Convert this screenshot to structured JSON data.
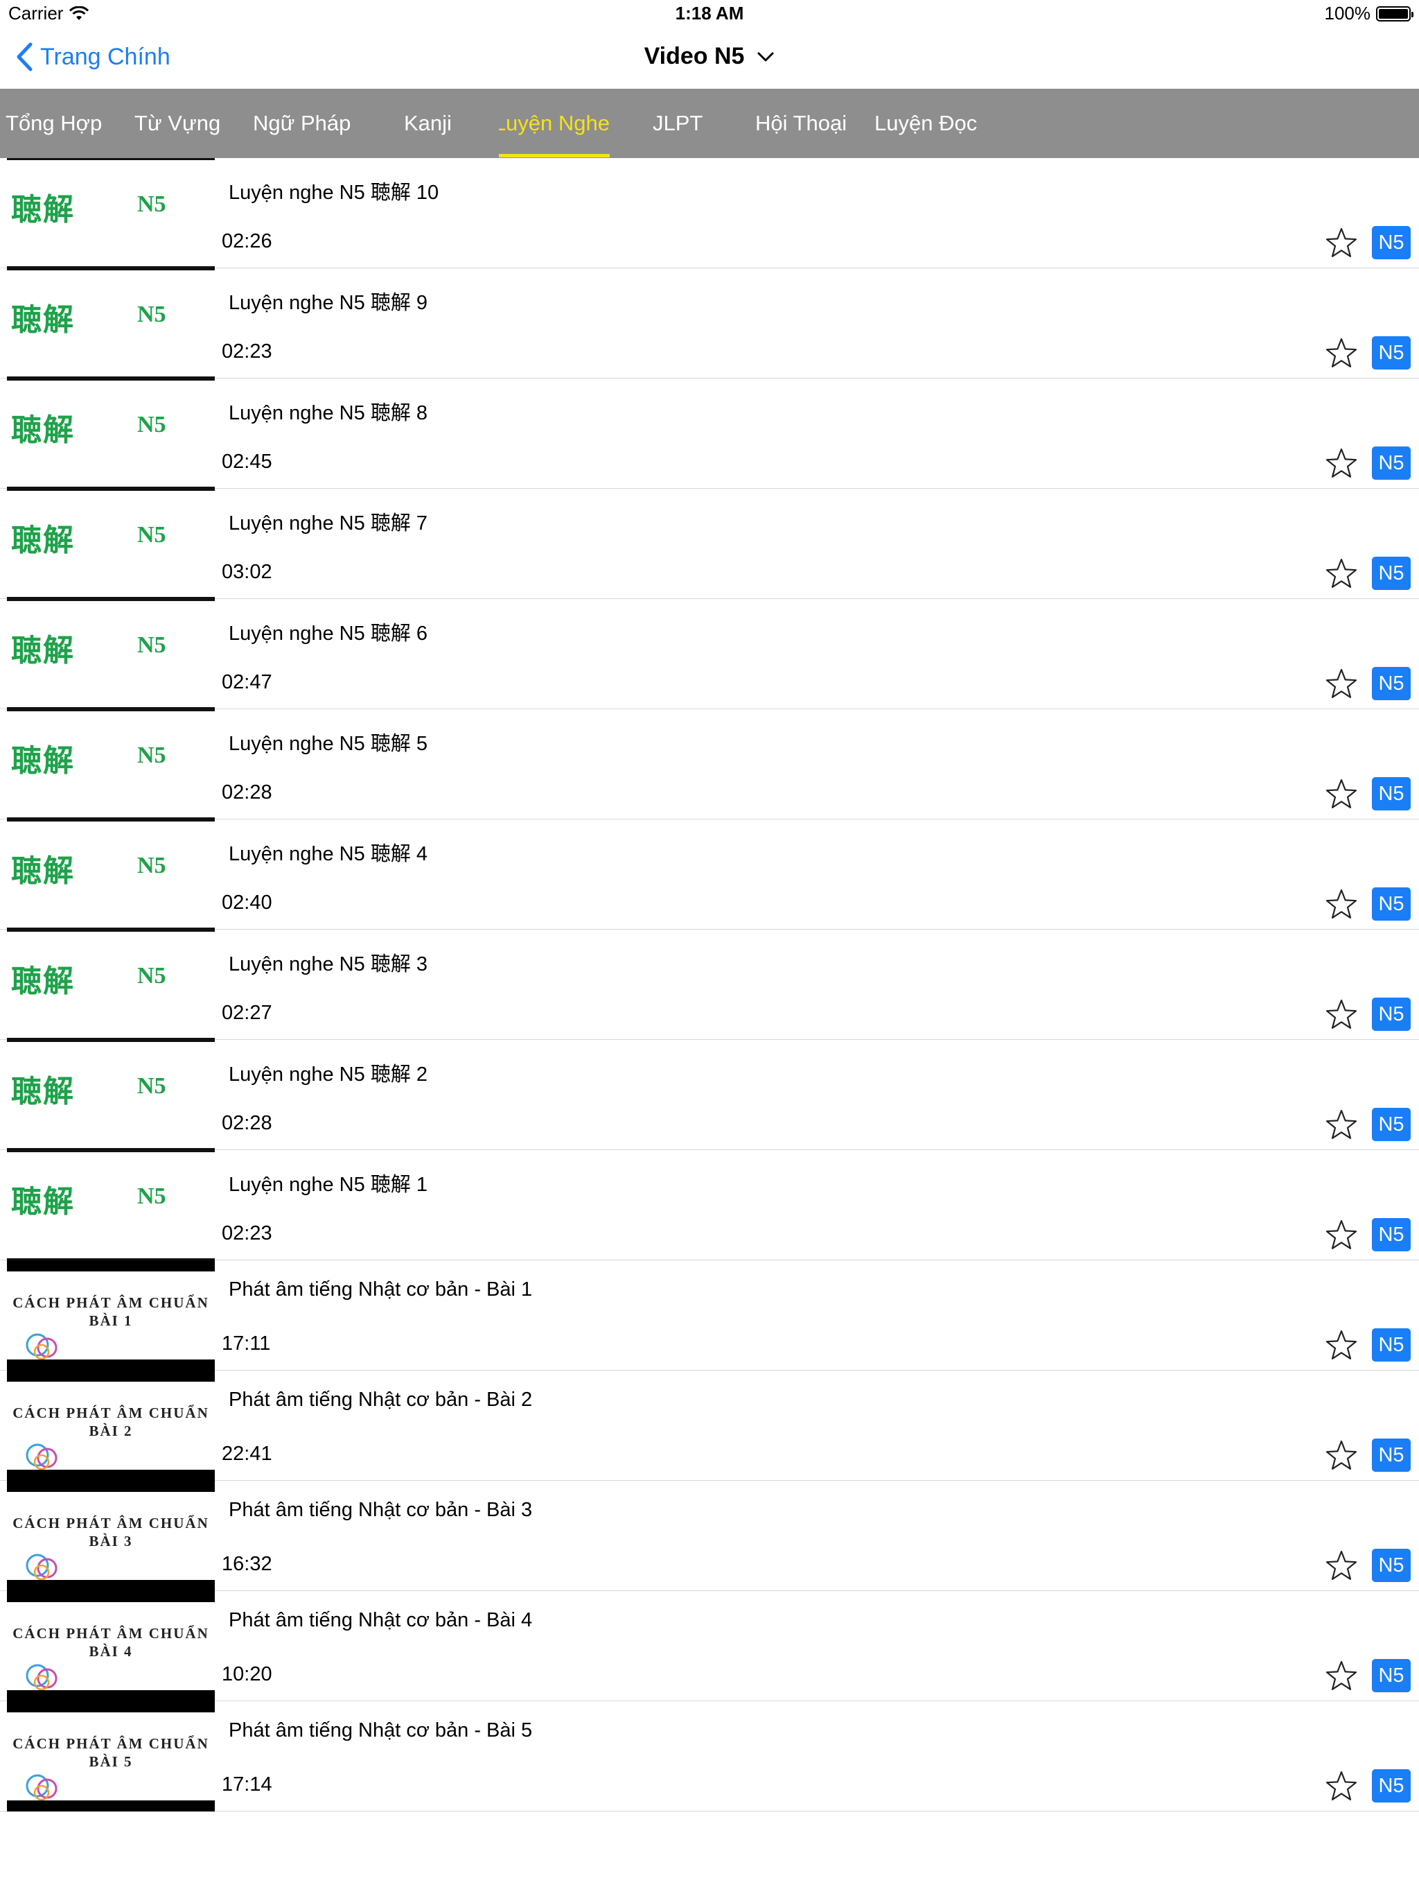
{
  "status_bar": {
    "carrier": "Carrier",
    "time": "1:18 AM",
    "battery": "100%"
  },
  "nav": {
    "back_label": "Trang Chính",
    "title": "Video N5"
  },
  "tabs": [
    {
      "label": "Tổng Hợp",
      "active": false
    },
    {
      "label": "Từ Vựng",
      "active": false
    },
    {
      "label": "Ngữ Pháp",
      "active": false
    },
    {
      "label": "Kanji",
      "active": false
    },
    {
      "label": "Luyện Nghe",
      "active": true
    },
    {
      "label": "JLPT",
      "active": false
    },
    {
      "label": "Hội Thoại",
      "active": false
    },
    {
      "label": "Luyện Đọc",
      "active": false
    }
  ],
  "colors": {
    "accent": "#1a7ef7",
    "tab_bg": "#8e8e8e",
    "tab_active": "#f5e21b",
    "thumb_green": "#1ea24a"
  },
  "listening_thumb": {
    "kanji": "聴解",
    "level": "N5"
  },
  "pronunciation_thumb": {
    "caption_line1": "CÁCH PHÁT ÂM CHUẨN"
  },
  "videos": [
    {
      "title": "Luyện nghe N5 聴解 10",
      "duration": "02:26",
      "badge": "N5",
      "thumb": "listening"
    },
    {
      "title": "Luyện nghe N5 聴解 9",
      "duration": "02:23",
      "badge": "N5",
      "thumb": "listening"
    },
    {
      "title": "Luyện nghe N5 聴解 8",
      "duration": "02:45",
      "badge": "N5",
      "thumb": "listening"
    },
    {
      "title": "Luyện nghe N5 聴解 7",
      "duration": "03:02",
      "badge": "N5",
      "thumb": "listening"
    },
    {
      "title": "Luyện nghe N5 聴解 6",
      "duration": "02:47",
      "badge": "N5",
      "thumb": "listening"
    },
    {
      "title": "Luyện nghe N5 聴解 5",
      "duration": "02:28",
      "badge": "N5",
      "thumb": "listening"
    },
    {
      "title": "Luyện nghe N5 聴解 4",
      "duration": "02:40",
      "badge": "N5",
      "thumb": "listening"
    },
    {
      "title": "Luyện nghe N5 聴解 3",
      "duration": "02:27",
      "badge": "N5",
      "thumb": "listening"
    },
    {
      "title": "Luyện nghe N5 聴解 2",
      "duration": "02:28",
      "badge": "N5",
      "thumb": "listening"
    },
    {
      "title": "Luyện nghe N5 聴解 1",
      "duration": "02:23",
      "badge": "N5",
      "thumb": "listening"
    },
    {
      "title": "Phát âm tiếng Nhật cơ bản - Bài 1",
      "duration": "17:11",
      "badge": "N5",
      "thumb": "pronunciation",
      "thumb_lesson": "BÀI 1"
    },
    {
      "title": "Phát âm tiếng Nhật cơ bản - Bài 2",
      "duration": "22:41",
      "badge": "N5",
      "thumb": "pronunciation",
      "thumb_lesson": "BÀI 2"
    },
    {
      "title": "Phát âm tiếng Nhật cơ bản - Bài 3",
      "duration": "16:32",
      "badge": "N5",
      "thumb": "pronunciation",
      "thumb_lesson": "BÀI 3"
    },
    {
      "title": "Phát âm tiếng Nhật cơ bản - Bài 4",
      "duration": "10:20",
      "badge": "N5",
      "thumb": "pronunciation",
      "thumb_lesson": "BÀI 4"
    },
    {
      "title": "Phát âm tiếng Nhật cơ bản - Bài 5",
      "duration": "17:14",
      "badge": "N5",
      "thumb": "pronunciation",
      "thumb_lesson": "BÀI 5"
    }
  ]
}
